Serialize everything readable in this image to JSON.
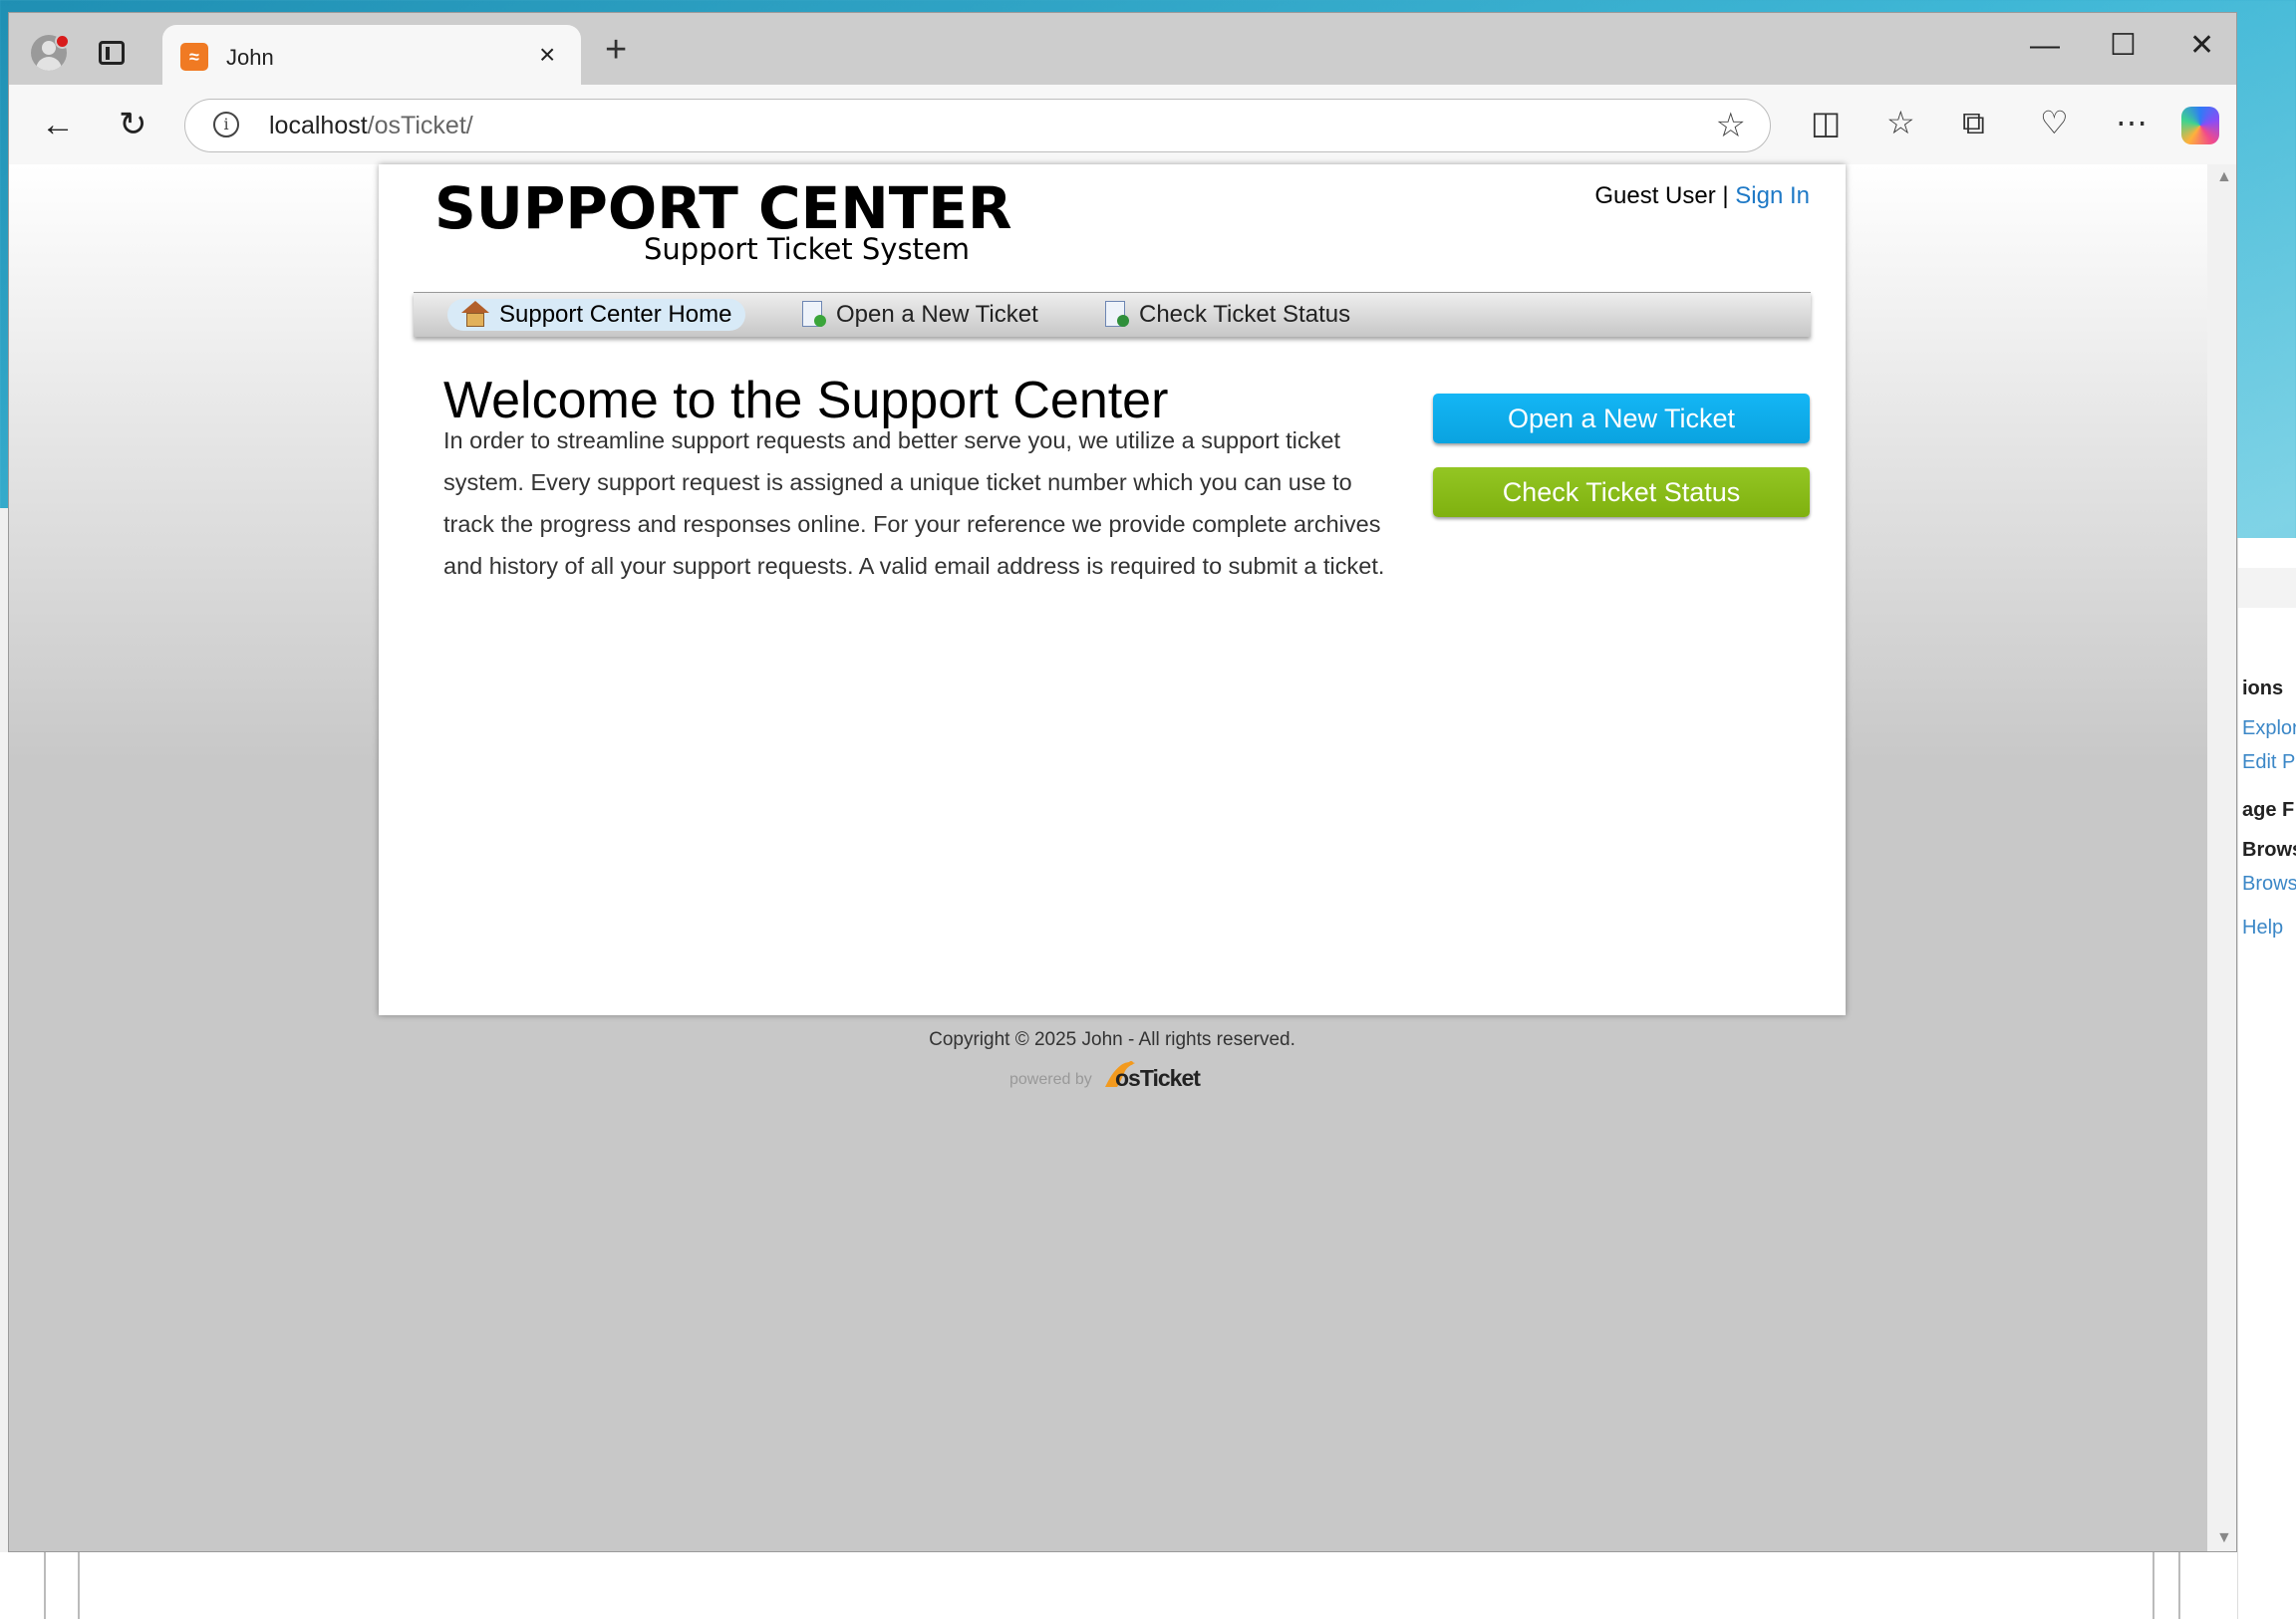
{
  "browser": {
    "tab_title": "John",
    "tab_close": "×",
    "new_tab": "+",
    "url_host": "localhost",
    "url_path": "/osTicket/",
    "win_minimize": "—",
    "win_maximize": "☐",
    "win_close": "✕"
  },
  "page": {
    "logo_main": "SUPPORT CENTER",
    "logo_sub": "Support Ticket System",
    "guest_label": "Guest User",
    "separator": " | ",
    "sign_in": "Sign In",
    "nav": [
      {
        "label": "Support Center Home",
        "active": true
      },
      {
        "label": "Open a New Ticket"
      },
      {
        "label": "Check Ticket Status"
      }
    ],
    "welcome_heading": "Welcome to the Support Center",
    "intro": "In order to streamline support requests and better serve you, we utilize a support ticket system. Every support request is assigned a unique ticket number which you can use to track the progress and responses online. For your reference we provide complete archives and history of all your support requests. A valid email address is required to submit a ticket.",
    "btn_open": "Open a New Ticket",
    "btn_check": "Check Ticket Status",
    "copyright": "Copyright © 2025 John - All rights reserved.",
    "powered_by": "powered by",
    "brand": "osTicket"
  },
  "background_app": {
    "items": [
      "ions",
      "Explor",
      "Edit P",
      "age F",
      "Brows",
      "Brows",
      "Help"
    ]
  },
  "colors": {
    "link": "#1e79c6",
    "btn_blue": "#0aa3e0",
    "btn_green": "#7fb10f"
  }
}
